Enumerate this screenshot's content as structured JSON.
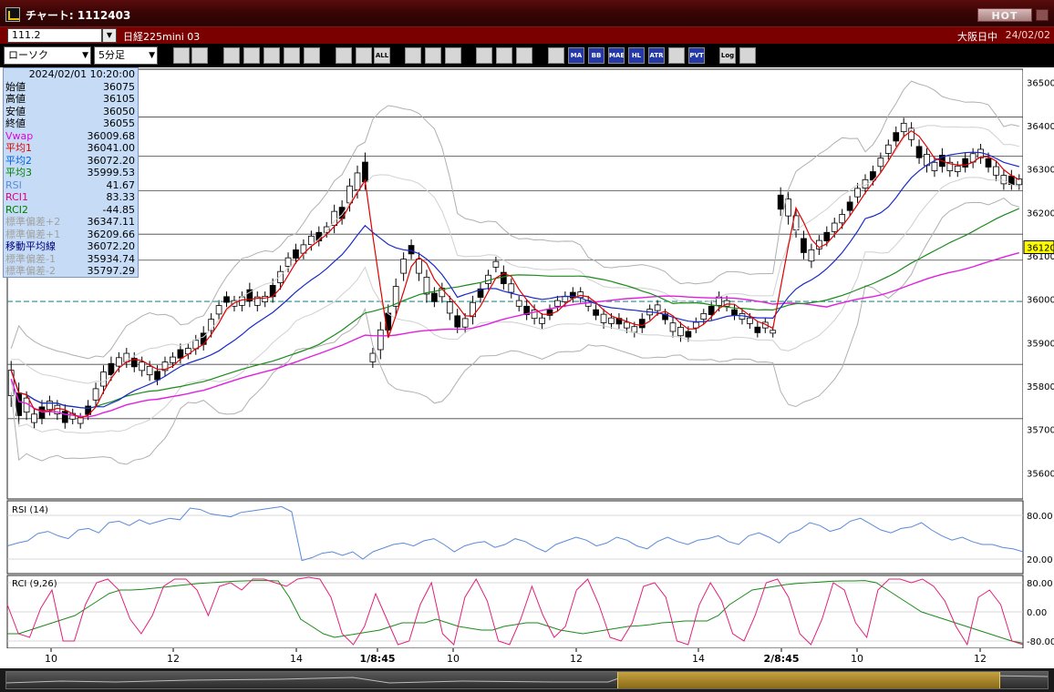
{
  "window": {
    "title": "チャート: 1112403",
    "hot_label": "HOT"
  },
  "infobar": {
    "symbol_value": "111.2",
    "instrument": "日経225mini 03",
    "session": "大阪日中",
    "date": "24/02/02"
  },
  "toolbar": {
    "chart_type": "ローソク",
    "interval": "5分足",
    "buttons": [
      {
        "icon": "zoom-icon",
        "text": ""
      },
      {
        "icon": "crosshair-icon",
        "text": ""
      },
      {
        "icon": "tool-icon-1",
        "text": ""
      },
      {
        "icon": "tool-icon-2",
        "text": ""
      },
      {
        "icon": "tool-icon-3",
        "text": ""
      },
      {
        "icon": "tool-icon-4",
        "text": ""
      },
      {
        "icon": "tool-icon-5",
        "text": ""
      },
      {
        "icon": "tool-icon-6",
        "text": ""
      },
      {
        "icon": "tool-icon-7",
        "text": ""
      },
      {
        "icon": "all-icon",
        "text": "ALL"
      },
      {
        "icon": "draw-line-icon",
        "text": ""
      },
      {
        "icon": "cursor-icon",
        "text": ""
      },
      {
        "icon": "undo-icon",
        "text": ""
      },
      {
        "icon": "settings-icon",
        "text": ""
      },
      {
        "icon": "brush-icon",
        "text": ""
      },
      {
        "icon": "palette-icon",
        "text": ""
      },
      {
        "icon": "volume-icon",
        "text": ""
      },
      {
        "icon": "ma-icon",
        "text": "MA"
      },
      {
        "icon": "bb-icon",
        "text": "BB"
      },
      {
        "icon": "mae-icon",
        "text": "MAE"
      },
      {
        "icon": "hl-icon",
        "text": "HL"
      },
      {
        "icon": "atr-icon",
        "text": "ATR"
      },
      {
        "icon": "ichimoku-icon",
        "text": ""
      },
      {
        "icon": "pvt-icon",
        "text": "PVT"
      },
      {
        "icon": "log-icon",
        "text": "Log"
      },
      {
        "icon": "export-icon",
        "text": ""
      }
    ]
  },
  "info_panel": {
    "datetime": "2024/02/01  10:20:00",
    "rows": [
      {
        "label": "始値",
        "value": "36075",
        "color": "#000000"
      },
      {
        "label": "高値",
        "value": "36105",
        "color": "#000000"
      },
      {
        "label": "安値",
        "value": "36050",
        "color": "#000000"
      },
      {
        "label": "終値",
        "value": "36055",
        "color": "#000000"
      },
      {
        "label": "Vwap",
        "value": "36009.68",
        "color": "#e000e0"
      },
      {
        "label": "平均1",
        "value": "36041.00",
        "color": "#e00000"
      },
      {
        "label": "平均2",
        "value": "36072.20",
        "color": "#0060e0"
      },
      {
        "label": "平均3",
        "value": "35999.53",
        "color": "#008000"
      },
      {
        "label": "RSI",
        "value": "41.67",
        "color": "#5a8ad8"
      },
      {
        "label": "RCI1",
        "value": "83.33",
        "color": "#e00080"
      },
      {
        "label": "RCI2",
        "value": "-44.85",
        "color": "#008000"
      },
      {
        "label": "標準偏差+2",
        "value": "36347.11",
        "color": "#a0a0a0"
      },
      {
        "label": "標準偏差+1",
        "value": "36209.66",
        "color": "#a0a0a0"
      },
      {
        "label": "移動平均線",
        "value": "36072.20",
        "color": "#000080"
      },
      {
        "label": "標準偏差-1",
        "value": "35934.74",
        "color": "#a0a0a0"
      },
      {
        "label": "標準偏差-2",
        "value": "35797.29",
        "color": "#a0a0a0"
      }
    ]
  },
  "chart_data": [
    {
      "type": "candlestick",
      "y_ticks": [
        "36500",
        "36400",
        "36300",
        "36200",
        "36100",
        "36000",
        "35900",
        "35800",
        "35700",
        "35600"
      ],
      "ylim": [
        35540,
        36530
      ],
      "current_price": "36120",
      "reference_line": 35995,
      "horizontal_levels": [
        36420,
        36330,
        36250,
        36150,
        36090,
        35850,
        35725
      ],
      "x_ticks": [
        "10",
        "12",
        "14",
        "1/8:45",
        "10",
        "12",
        "14",
        "2/8:45",
        "10",
        "12"
      ],
      "colors": {
        "ma1": "#e00000",
        "ma2": "#1a2ac8",
        "ma3": "#1a8a1a",
        "vwap": "#e020e0",
        "bands": "#b0b0b0"
      },
      "candles": [
        [
          35850,
          35760
        ],
        [
          35800,
          35720
        ],
        [
          35780,
          35730
        ],
        [
          35740,
          35710
        ],
        [
          35760,
          35720
        ],
        [
          35770,
          35740
        ],
        [
          35760,
          35730
        ],
        [
          35750,
          35710
        ],
        [
          35740,
          35720
        ],
        [
          35730,
          35710
        ],
        [
          35760,
          35730
        ],
        [
          35800,
          35760
        ],
        [
          35840,
          35790
        ],
        [
          35860,
          35820
        ],
        [
          35870,
          35840
        ],
        [
          35880,
          35850
        ],
        [
          35870,
          35840
        ],
        [
          35860,
          35830
        ],
        [
          35850,
          35820
        ],
        [
          35840,
          35810
        ],
        [
          35860,
          35830
        ],
        [
          35870,
          35850
        ],
        [
          35890,
          35860
        ],
        [
          35890,
          35870
        ],
        [
          35910,
          35880
        ],
        [
          35930,
          35890
        ],
        [
          35960,
          35920
        ],
        [
          35990,
          35960
        ],
        [
          36010,
          35990
        ],
        [
          36000,
          35980
        ],
        [
          36010,
          35980
        ],
        [
          36030,
          35990
        ],
        [
          36010,
          35980
        ],
        [
          36010,
          35990
        ],
        [
          36040,
          36000
        ],
        [
          36070,
          36030
        ],
        [
          36100,
          36070
        ],
        [
          36120,
          36090
        ],
        [
          36130,
          36100
        ],
        [
          36150,
          36120
        ],
        [
          36160,
          36130
        ],
        [
          36170,
          36150
        ],
        [
          36210,
          36160
        ],
        [
          36220,
          36180
        ],
        [
          36270,
          36210
        ],
        [
          36300,
          36240
        ],
        [
          36330,
          36260
        ],
        [
          35880,
          35850
        ],
        [
          35940,
          35870
        ],
        [
          35980,
          35920
        ],
        [
          36040,
          35970
        ],
        [
          36100,
          36050
        ],
        [
          36130,
          36100
        ],
        [
          36100,
          36050
        ],
        [
          36060,
          36000
        ],
        [
          36020,
          35990
        ],
        [
          36030,
          36000
        ],
        [
          36000,
          35960
        ],
        [
          35970,
          35930
        ],
        [
          35960,
          35930
        ],
        [
          36000,
          35950
        ],
        [
          36030,
          36000
        ],
        [
          36060,
          36030
        ],
        [
          36090,
          36070
        ],
        [
          36070,
          36030
        ],
        [
          36040,
          36010
        ],
        [
          36000,
          35980
        ],
        [
          35990,
          35960
        ],
        [
          35980,
          35950
        ],
        [
          35960,
          35940
        ],
        [
          35980,
          35960
        ],
        [
          36000,
          35980
        ],
        [
          36010,
          35990
        ],
        [
          36020,
          36000
        ],
        [
          36020,
          36000
        ],
        [
          36000,
          35980
        ],
        [
          35980,
          35960
        ],
        [
          35970,
          35940
        ],
        [
          35960,
          35940
        ],
        [
          35960,
          35940
        ],
        [
          35950,
          35930
        ],
        [
          35940,
          35920
        ],
        [
          35960,
          35930
        ],
        [
          35980,
          35960
        ],
        [
          35990,
          35970
        ],
        [
          35970,
          35950
        ],
        [
          35950,
          35920
        ],
        [
          35940,
          35910
        ],
        [
          35930,
          35910
        ],
        [
          35950,
          35930
        ],
        [
          35970,
          35950
        ],
        [
          35990,
          35960
        ],
        [
          36010,
          35980
        ],
        [
          36000,
          35980
        ],
        [
          35980,
          35960
        ],
        [
          35970,
          35950
        ],
        [
          35960,
          35940
        ],
        [
          35940,
          35920
        ],
        [
          35950,
          35930
        ],
        [
          35930,
          35920
        ],
        [
          36250,
          36200
        ],
        [
          36240,
          36180
        ],
        [
          36200,
          36150
        ],
        [
          36150,
          36100
        ],
        [
          36120,
          36080
        ],
        [
          36140,
          36110
        ],
        [
          36160,
          36130
        ],
        [
          36180,
          36150
        ],
        [
          36200,
          36170
        ],
        [
          36230,
          36200
        ],
        [
          36260,
          36230
        ],
        [
          36280,
          36250
        ],
        [
          36300,
          36270
        ],
        [
          36330,
          36300
        ],
        [
          36360,
          36330
        ],
        [
          36390,
          36360
        ],
        [
          36410,
          36380
        ],
        [
          36400,
          36360
        ],
        [
          36360,
          36320
        ],
        [
          36340,
          36300
        ],
        [
          36320,
          36290
        ],
        [
          36340,
          36300
        ],
        [
          36320,
          36290
        ],
        [
          36310,
          36290
        ],
        [
          36330,
          36300
        ],
        [
          36340,
          36310
        ],
        [
          36350,
          36320
        ],
        [
          36330,
          36300
        ],
        [
          36310,
          36280
        ],
        [
          36290,
          36260
        ],
        [
          36290,
          36260
        ],
        [
          36280,
          36260
        ]
      ]
    },
    {
      "type": "line",
      "title": "RSI (14)",
      "y_ticks": [
        "80.00",
        "20.00"
      ],
      "ylim": [
        0,
        100
      ],
      "values": [
        38,
        42,
        45,
        55,
        58,
        52,
        48,
        60,
        62,
        56,
        70,
        72,
        66,
        74,
        68,
        72,
        76,
        74,
        90,
        88,
        82,
        80,
        78,
        84,
        86,
        88,
        90,
        92,
        85,
        18,
        22,
        28,
        30,
        25,
        30,
        20,
        30,
        35,
        40,
        42,
        38,
        45,
        48,
        40,
        30,
        38,
        42,
        44,
        36,
        40,
        48,
        44,
        36,
        30,
        40,
        45,
        50,
        46,
        38,
        42,
        50,
        46,
        38,
        34,
        44,
        50,
        44,
        40,
        46,
        48,
        52,
        44,
        40,
        52,
        56,
        50,
        42,
        55,
        60,
        70,
        66,
        58,
        62,
        72,
        76,
        68,
        60,
        56,
        62,
        64,
        70,
        60,
        52,
        46,
        50,
        44,
        40,
        40,
        36,
        34,
        30
      ]
    },
    {
      "type": "line",
      "title": "RCI (9,26)",
      "y_ticks": [
        "80.00",
        "0.00",
        "-80.00"
      ],
      "ylim": [
        -100,
        100
      ],
      "series_rci1": [
        20,
        -60,
        -70,
        10,
        60,
        -80,
        -80,
        20,
        80,
        90,
        60,
        -20,
        -60,
        -10,
        70,
        90,
        90,
        60,
        -10,
        70,
        80,
        60,
        90,
        90,
        80,
        70,
        90,
        95,
        90,
        40,
        -60,
        -90,
        -40,
        50,
        -20,
        -90,
        -80,
        20,
        80,
        -60,
        -90,
        40,
        90,
        30,
        -80,
        -90,
        -20,
        70,
        -10,
        -70,
        -40,
        60,
        90,
        20,
        -70,
        -80,
        -30,
        70,
        80,
        40,
        -80,
        -90,
        20,
        80,
        30,
        -60,
        -80,
        -10,
        80,
        90,
        40,
        -60,
        -90,
        -20,
        80,
        60,
        -30,
        -70,
        60,
        90,
        90,
        80,
        90,
        70,
        30,
        -40,
        -90,
        40,
        60,
        20,
        -80,
        -90
      ],
      "series_rci2": [
        -60,
        -60,
        -50,
        -40,
        -30,
        -20,
        -10,
        10,
        30,
        50,
        60,
        60,
        62,
        65,
        68,
        72,
        75,
        78,
        80,
        82,
        84,
        85,
        86,
        86,
        85,
        40,
        -20,
        -40,
        -60,
        -70,
        -65,
        -60,
        -55,
        -50,
        -40,
        -30,
        -30,
        -30,
        -20,
        -30,
        -40,
        -45,
        -50,
        -50,
        -40,
        -35,
        -30,
        -30,
        -40,
        -50,
        -55,
        -60,
        -55,
        -50,
        -45,
        -40,
        -38,
        -35,
        -30,
        -28,
        -25,
        -25,
        -25,
        -10,
        20,
        40,
        60,
        65,
        70,
        75,
        78,
        80,
        82,
        84,
        85,
        85,
        86,
        80,
        60,
        40,
        20,
        0,
        -10,
        -20,
        -30,
        -40,
        -50,
        -60,
        -70,
        -80,
        -86
      ]
    }
  ]
}
